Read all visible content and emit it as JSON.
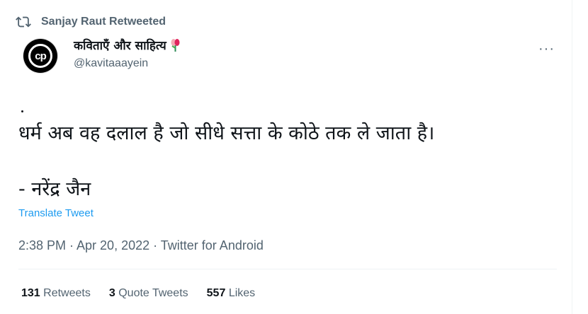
{
  "retweet": {
    "label": "Sanjay Raut Retweeted",
    "icon": "retweet-icon"
  },
  "author": {
    "display_name": "कविताएँ और साहित्य",
    "badge_icon": "flower-bouquet-icon",
    "handle": "@kavitaaayein",
    "avatar_text": "cp",
    "avatar_icon": "profile-avatar-logo"
  },
  "menu": {
    "more_label": "···"
  },
  "tweet": {
    "line1": "धर्म अब वह दलाल है जो सीधे सत्ता के कोठे तक ले जाता है।",
    "line2": "- नरेंद्र जैन"
  },
  "translate_label": "Translate Tweet",
  "meta": {
    "text": "2:38 PM · Apr 20, 2022 · Twitter for Android"
  },
  "stats": {
    "retweets_count": "131",
    "retweets_label": "Retweets",
    "quotes_count": "3",
    "quotes_label": "Quote Tweets",
    "likes_count": "557",
    "likes_label": "Likes"
  },
  "colors": {
    "text": "#0f1419",
    "secondary": "#536471",
    "link": "#1d9bf0"
  }
}
